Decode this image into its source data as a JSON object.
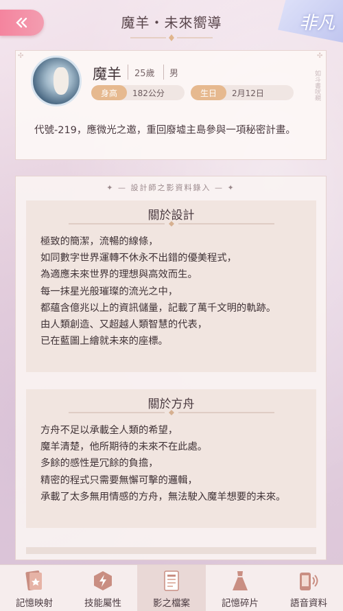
{
  "header": {
    "title": "魔羊・未來嚮導",
    "logo_text": "非凡"
  },
  "profile": {
    "name": "魔羊",
    "age": "25歲",
    "gender": "男",
    "height_label": "身高",
    "height_value": "182公分",
    "birthday_label": "生日",
    "birthday_value": "2月12日",
    "description": "代號-219，應微光之邀，重回廢墟主島參與一項秘密計畫。",
    "side_text": "如斗書吠覡"
  },
  "panel": {
    "header": "設計師之影資料錄入",
    "sections": [
      {
        "title": "關於設計",
        "body": "極致的簡潔，流暢的線條，\n如同數字世界運轉不休永不出錯的優美程式，\n為適應未來世界的理想與高效而生。\n每一抹星光般璀璨的流光之中，\n都蘊含億兆以上的資訊儲量，記載了萬千文明的軌跡。\n由人類創造、又超越人類智慧的代表，\n已在藍圖上繪就未來的座標。"
      },
      {
        "title": "關於方舟",
        "body": "方舟不足以承載全人類的希望，\n魔羊清楚，他所期待的未來不在此處。\n多餘的感性是冗餘的負擔，\n精密的程式只需要無懈可擊的邏輯，\n承載了太多無用情感的方舟，無法駛入魔羊想要的未來。"
      }
    ]
  },
  "tabs": [
    {
      "label": "記憶映射",
      "icon": "memory-card-icon",
      "active": false
    },
    {
      "label": "技能屬性",
      "icon": "lightning-icon",
      "active": false
    },
    {
      "label": "影之檔案",
      "icon": "document-icon",
      "active": true
    },
    {
      "label": "記憶碎片",
      "icon": "dress-icon",
      "active": false
    },
    {
      "label": "語音資料",
      "icon": "phone-audio-icon",
      "active": false
    }
  ],
  "colors": {
    "accent_pink": "#f4849e",
    "stat_label": "#e6b98f",
    "active_tab": "#e9d8d6"
  }
}
